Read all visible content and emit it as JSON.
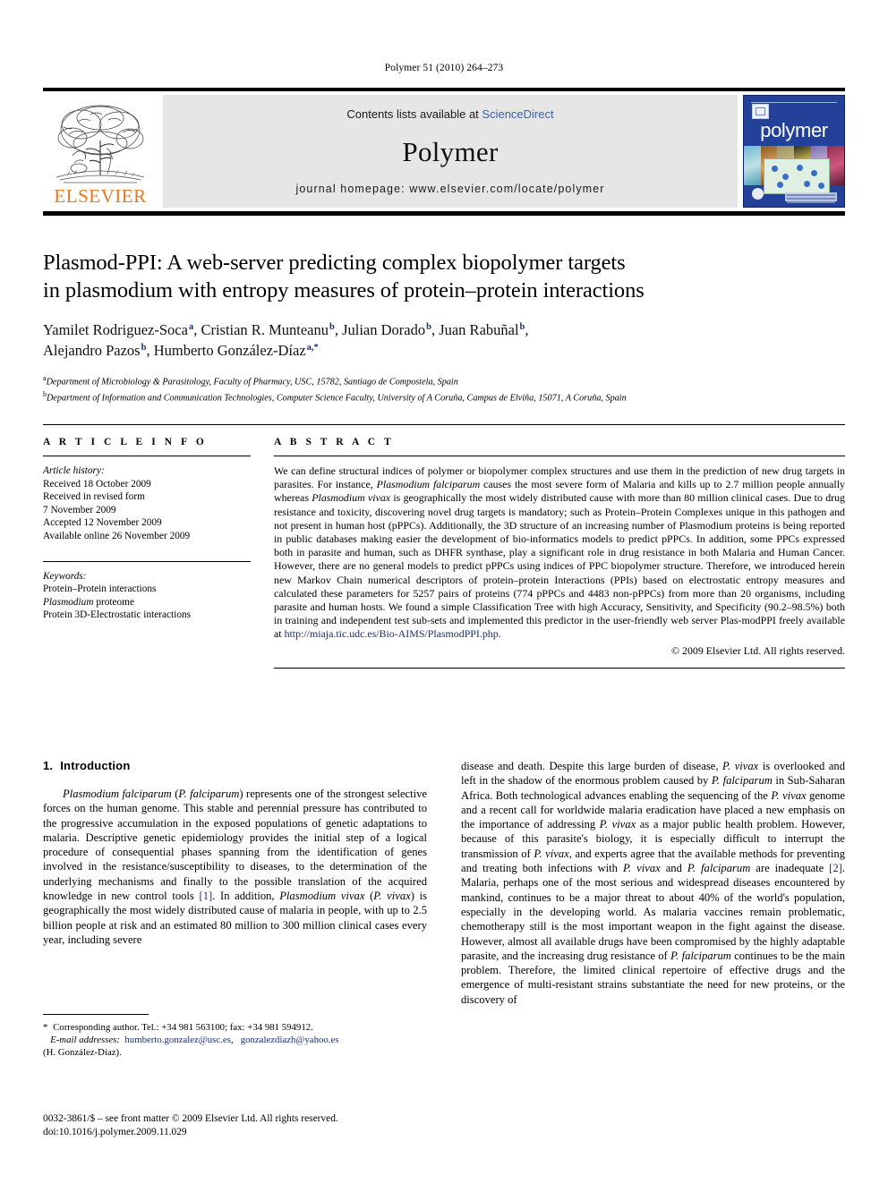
{
  "running_head": "Polymer 51 (2010) 264–273",
  "journal_header": {
    "contents_prefix": "Contents lists available at ",
    "sciencedirect": "ScienceDirect",
    "journal_name": "Polymer",
    "homepage": "journal homepage: www.elsevier.com/locate/polymer",
    "publisher_logo_text": "ELSEVIER",
    "cover_title": "polymer",
    "colors": {
      "elsevier_orange": "#E87722",
      "sciencedirect_blue": "#3a63b0",
      "cover_blue": "#24419a",
      "band_grey": "#e6e6e6",
      "link_navy": "#1a2f6e"
    }
  },
  "title": {
    "line1": "Plasmod-PPI: A web-server predicting complex biopolymer targets",
    "line2": "in plasmodium with entropy measures of protein–protein interactions"
  },
  "authors": [
    {
      "name": "Yamilet Rodriguez-Soca",
      "marks": "a",
      "sep": ", "
    },
    {
      "name": "Cristian R. Munteanu",
      "marks": "b",
      "sep": ", "
    },
    {
      "name": "Julian Dorado",
      "marks": "b",
      "sep": ", "
    },
    {
      "name": "Juan Rabuñal",
      "marks": "b",
      "sep": ","
    },
    {
      "name": "Alejandro Pazos",
      "marks": "b",
      "sep": ", "
    },
    {
      "name": "Humberto González-Díaz",
      "marks": "a,*",
      "sep": ""
    }
  ],
  "affiliations": [
    {
      "mark": "a",
      "text": "Department of Microbiology & Parasitology, Faculty of Pharmacy, USC, 15782, Santiago de Compostela, Spain"
    },
    {
      "mark": "b",
      "text": "Department of Information and Communication Technologies, Computer Science Faculty, University of A Coruña, Campus de Elviña, 15071, A Coruña, Spain"
    }
  ],
  "article_info": {
    "label": "A R T I C L E    I N F O",
    "history_head": "Article history:",
    "history": [
      "Received 18 October 2009",
      "Received in revised form",
      "7 November 2009",
      "Accepted 12 November 2009",
      "Available online 26 November 2009"
    ],
    "keywords_head": "Keywords:",
    "keywords": [
      "Protein–Protein interactions",
      "Plasmodium proteome",
      "Protein 3D-Electrostatic interactions"
    ]
  },
  "abstract": {
    "label": "A B S T R A C T",
    "part1": "We can define structural indices of polymer or biopolymer complex structures and use them in the prediction of new drug targets in parasites. For instance, ",
    "sp1": "Plasmodium falciparum",
    "part2": " causes the most severe form of Malaria and kills up to 2.7 million people annually whereas ",
    "sp2": "Plasmodium vivax",
    "part3": " is geographically the most widely distributed cause with more than 80 million clinical cases. Due to drug resistance and toxicity, discovering novel drug targets is mandatory; such as Protein–Protein Complexes unique in this pathogen and not present in human host (pPPCs). Additionally, the 3D structure of an increasing number of Plasmodium proteins is being reported in public databases making easier the development of bio-informatics models to predict pPPCs. In addition, some PPCs expressed both in parasite and human, such as DHFR synthase, play a significant role in drug resistance in both Malaria and Human Cancer. However, there are no general models to predict pPPCs using indices of PPC biopolymer structure. Therefore, we introduced herein new Markov Chain numerical descriptors of protein–protein Interactions (PPIs) based on electrostatic entropy measures and calculated these parameters for 5257 pairs of proteins (774 pPPCs and 4483 non-pPPCs) from more than 20 organisms, including parasite and human hosts. We found a simple Classification Tree with high Accuracy, Sensitivity, and Specificity (90.2–98.5%) both in training and independent test sub-sets and implemented this predictor in the user-friendly web server Plas-modPPI freely available at ",
    "url": "http://miaja.tic.udc.es/Bio-AIMS/PlasmodPPI.php",
    "part4": ".",
    "copyright": "© 2009 Elsevier Ltd. All rights reserved."
  },
  "introduction": {
    "number": "1.",
    "heading": "Introduction",
    "left_p1_a": "",
    "left_sp1": "Plasmodium falciparum",
    "left_b": " (",
    "left_sp2": "P. falciparum",
    "left_c": ") represents one of the strongest selective forces on the human genome. This stable and perennial pressure has contributed to the progressive accumulation in the exposed populations of genetic adaptations to malaria. Descriptive genetic epidemiology provides the initial step of a logical procedure of consequential phases spanning from the identification of genes involved in the resistance/susceptibility to diseases, to the determination of the underlying mechanisms and finally to the possible translation of the acquired knowledge in new control tools ",
    "ref1": "[1]",
    "left_d": ". In addition, ",
    "left_sp3": "Plasmodium vivax",
    "left_e": " (",
    "left_sp4": "P. vivax",
    "left_f": ") is geographically the most widely distributed cause of malaria in people, with up to 2.5 billion people at risk and an estimated 80 million to 300 million clinical cases every year, including severe",
    "right_a": "disease and death. Despite this large burden of disease, ",
    "right_sp1": "P. vivax",
    "right_b": " is overlooked and left in the shadow of the enormous problem caused by ",
    "right_sp2": "P. falciparum",
    "right_c": " in Sub-Saharan Africa. Both technological advances enabling the sequencing of the ",
    "right_sp3": "P. vivax",
    "right_d": " genome and a recent call for worldwide malaria eradication have placed a new emphasis on the importance of addressing ",
    "right_sp4": "P. vivax",
    "right_e": " as a major public health problem. However, because of this parasite's biology, it is especially difficult to interrupt the transmission of ",
    "right_sp5": "P. vivax",
    "right_f": ", and experts agree that the available methods for preventing and treating both infections with ",
    "right_sp6": "P. vivax",
    "right_g": " and ",
    "right_sp7": "P. falciparum",
    "right_h": " are inadequate ",
    "ref2": "[2]",
    "right_i": ". Malaria, perhaps one of the most serious and widespread diseases encountered by mankind, continues to be a major threat to about 40% of the world's population, especially in the developing world. As malaria vaccines remain problematic, chemotherapy still is the most important weapon in the fight against the disease. However, almost all available drugs have been compromised by the highly adaptable parasite, and the increasing drug resistance of ",
    "right_sp8": "P. falciparum",
    "right_j": " continues to be the main problem. Therefore, the limited clinical repertoire of effective drugs and the emergence of multi-resistant strains substantiate the need for new proteins, or the discovery of"
  },
  "footnote": {
    "star": "*",
    "corresponding": " Corresponding author. Tel.: +34 981 563100; fax: +34 981 594912.",
    "email_label": "E-mail addresses:",
    "email1": "humberto.gonzalez@usc.es",
    "email_sep": ", ",
    "email2": "gonzalezdiazh@yahoo.es",
    "email_owner": "(H. González-Díaz)."
  },
  "publisher": {
    "line1": "0032-3861/$ – see front matter © 2009 Elsevier Ltd. All rights reserved.",
    "line2": "doi:10.1016/j.polymer.2009.11.029"
  }
}
